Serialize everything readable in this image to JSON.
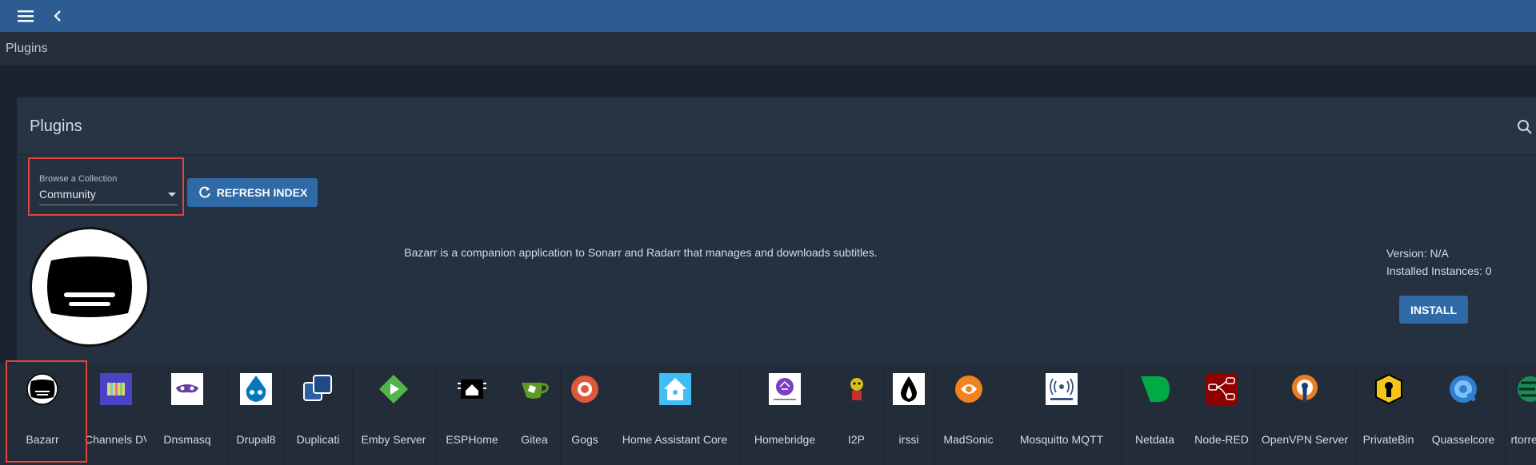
{
  "header": {
    "menu_icon": "hamburger-icon",
    "back_icon": "chevron-left-icon"
  },
  "breadcrumb": {
    "title": "Plugins"
  },
  "card": {
    "title": "Plugins",
    "search_icon": "search-icon",
    "collection": {
      "label": "Browse a Collection",
      "value": "Community"
    },
    "refresh_label": "REFRESH INDEX",
    "selected": {
      "name": "Bazarr",
      "description": "Bazarr is a companion application to Sonarr and Radarr that manages and downloads subtitles.",
      "version": "Version: N/A",
      "instances": "Installed Instances: 0",
      "install_label": "INSTALL"
    }
  },
  "plugins": [
    {
      "name": "Bazarr",
      "icon": "bazarr-icon",
      "color": "#ffffff"
    },
    {
      "name": "Channels DVR",
      "icon": "channels-dvr-icon",
      "color": "#5a4fd0"
    },
    {
      "name": "Dnsmasq",
      "icon": "dnsmasq-icon",
      "color": "#6b3fa0"
    },
    {
      "name": "Drupal8",
      "icon": "drupal-icon",
      "color": "#0678be"
    },
    {
      "name": "Duplicati",
      "icon": "duplicati-icon",
      "color": "#2c5ea0"
    },
    {
      "name": "Emby Server",
      "icon": "emby-icon",
      "color": "#52b54b"
    },
    {
      "name": "ESPHome",
      "icon": "esphome-icon",
      "color": "#000000"
    },
    {
      "name": "Gitea",
      "icon": "gitea-icon",
      "color": "#609926"
    },
    {
      "name": "Gogs",
      "icon": "gogs-icon",
      "color": "#e0583a"
    },
    {
      "name": "Home Assistant Core",
      "icon": "home-assistant-icon",
      "color": "#41bdf5"
    },
    {
      "name": "Homebridge",
      "icon": "homebridge-icon",
      "color": "#7a3fc4"
    },
    {
      "name": "I2P",
      "icon": "i2p-icon",
      "color": "#d4c018"
    },
    {
      "name": "irssi",
      "icon": "irssi-icon",
      "color": "#000000"
    },
    {
      "name": "MadSonic",
      "icon": "madsonic-icon",
      "color": "#f0831e"
    },
    {
      "name": "Mosquitto MQTT",
      "icon": "mosquitto-icon",
      "color": "#3c5280"
    },
    {
      "name": "Netdata",
      "icon": "netdata-icon",
      "color": "#00ab44"
    },
    {
      "name": "Node-RED",
      "icon": "node-red-icon",
      "color": "#8f0000"
    },
    {
      "name": "OpenVPN Server",
      "icon": "openvpn-icon",
      "color": "#ea7e20"
    },
    {
      "name": "PrivateBin",
      "icon": "privatebin-icon",
      "color": "#f5c518"
    },
    {
      "name": "Quasselcore",
      "icon": "quasselcore-icon",
      "color": "#2f7fd1"
    },
    {
      "name": "rtorrent",
      "icon": "rtorrent-icon",
      "color": "#1a8a5a"
    }
  ]
}
